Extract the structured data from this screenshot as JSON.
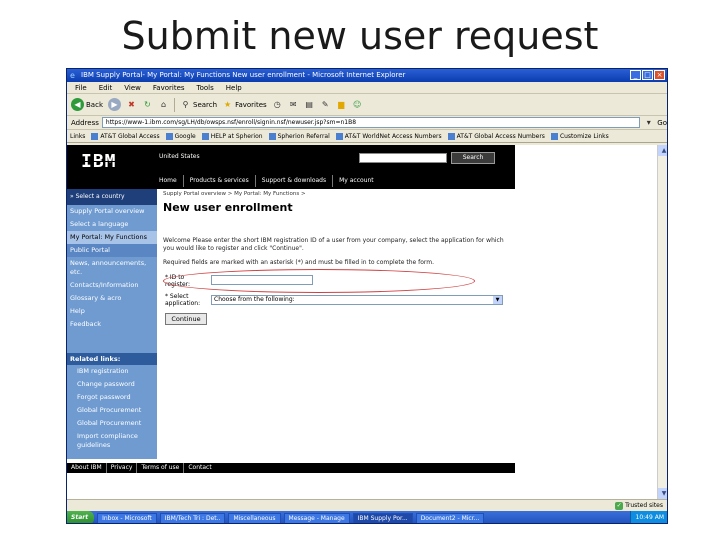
{
  "slide": {
    "title": "Submit new user request"
  },
  "window": {
    "title": "IBM Supply Portal- My Portal: My Functions New user enrollment - Microsoft Internet Explorer",
    "controls": [
      "_",
      "□",
      "×"
    ]
  },
  "menubar": [
    "File",
    "Edit",
    "View",
    "Favorites",
    "Tools",
    "Help"
  ],
  "toolbar": {
    "back_label": "Back",
    "search_label": "Search",
    "favorites_label": "Favorites"
  },
  "address": {
    "label": "Address",
    "url": "https://www-1.ibm.com/sg/LH/db/owsps.nsf/enroll/signin.nsf/newuser.jsp?sm=n1B8",
    "go_label": "Go"
  },
  "links": {
    "label": "Links",
    "items": [
      "AT&T Global Access",
      "Google",
      "HELP at Spherion",
      "Spherion Referral",
      "AT&T WorldNet Access Numbers",
      "AT&T Global Access Numbers",
      "Customize Links"
    ]
  },
  "ibm_page": {
    "logo": "IBM",
    "country": "United States",
    "search_button": "Search",
    "topnav": [
      "Home",
      "Products & services",
      "Support & downloads",
      "My account"
    ],
    "leftnav": {
      "select_country": "» Select a country",
      "items": [
        "Supply Portal overview",
        "Select a language",
        "My Portal: My Functions",
        "Public Portal",
        "News, announcements, etc.",
        "Contacts/Information",
        "Glossary & acro",
        "Help",
        "Feedback"
      ],
      "related_heading": "Related links:",
      "related": [
        "IBM registration",
        "Change password",
        "Forgot password",
        "Global Procurement",
        "Global Procurement",
        "Import compliance guidelines"
      ]
    },
    "breadcrumb": "Supply Portal overview  >  My Portal: My Functions  >",
    "page_title": "New user enrollment",
    "intro": "Welcome                    Please enter the short IBM registration ID of a user from your company, select the application for which you would like to register and click \"Continue\".",
    "required_note": "Required fields are marked with an asterisk (*) and must be filled in to complete the form.",
    "field_id_label": "* ID to register:",
    "field_app_label": "* Select application:",
    "select_value": "Choose from the following:",
    "continue_label": "Continue",
    "footer": [
      "About IBM",
      "Privacy",
      "Terms of use",
      "Contact"
    ]
  },
  "statusbar": {
    "zone": "Trusted sites"
  },
  "taskbar": {
    "start": "Start",
    "tasks": [
      "Inbox - Microsoft",
      "IBM/Tech Tri : Det..",
      "Miscellaneous",
      "Message - Manage",
      "IBM Supply Por...",
      "Document2 - Micr..."
    ],
    "active_index": 4,
    "clock": "10:49 AM"
  }
}
